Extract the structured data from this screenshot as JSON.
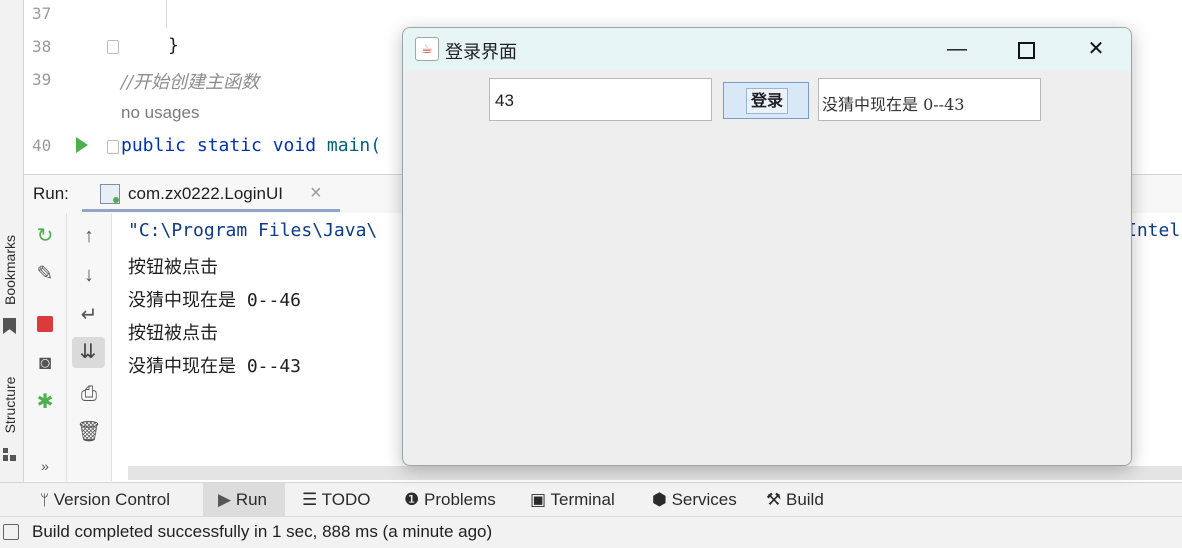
{
  "sidebar": {
    "bookmarks_label": "Bookmarks",
    "structure_label": "Structure"
  },
  "editor": {
    "line_numbers": [
      "37",
      "38",
      "39",
      "40"
    ],
    "brace": "}",
    "comment": "//开始创建主函数",
    "usages_hint": "no usages",
    "main_keywords": "public static void",
    "main_name": "main("
  },
  "run": {
    "label": "Run:",
    "tab_label": "com.zx0222.LoginUI",
    "close": "×"
  },
  "console": {
    "lines": [
      "\"C:\\Program Files\\Java\\",
      "按钮被点击",
      "没猜中现在是 0--46",
      "按钮被点击",
      "没猜中现在是 0--43"
    ],
    "cutoff_right": "Intel"
  },
  "bottom_tabs": [
    {
      "label": "Version Control",
      "icon": "branch-icon"
    },
    {
      "label": "Run",
      "icon": "play-icon"
    },
    {
      "label": "TODO",
      "icon": "list-icon"
    },
    {
      "label": "Problems",
      "icon": "problems-icon"
    },
    {
      "label": "Terminal",
      "icon": "terminal-icon"
    },
    {
      "label": "Services",
      "icon": "services-icon"
    },
    {
      "label": "Build",
      "icon": "hammer-icon"
    }
  ],
  "status": {
    "message": "Build completed successfully in 1 sec, 888 ms (a minute ago)"
  },
  "login_window": {
    "title": "登录界面",
    "input_value": "43",
    "login_button": "登录",
    "result_value": "没猜中现在是 0--43",
    "app_icon": "java-icon"
  },
  "colors": {
    "keyword": "#0033b3",
    "comment": "#8c8c8c",
    "run_green": "#4caf50",
    "stop_red": "#db3b3b"
  }
}
